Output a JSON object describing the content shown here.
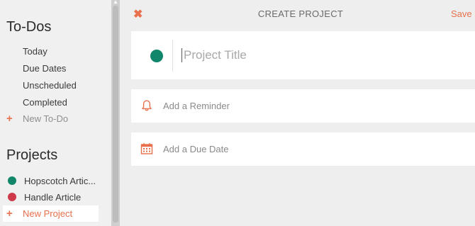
{
  "sidebar": {
    "todos_title": "To-Dos",
    "todo_items": [
      {
        "label": "Today"
      },
      {
        "label": "Due Dates"
      },
      {
        "label": "Unscheduled"
      },
      {
        "label": "Completed"
      }
    ],
    "new_todo_label": "New To-Do",
    "projects_title": "Projects",
    "projects": [
      {
        "label": "Hopscotch Artic...",
        "color": "#11866b"
      },
      {
        "label": "Handle Article",
        "color": "#cf3a4a"
      }
    ],
    "new_project_label": "New Project"
  },
  "header": {
    "close_icon": "close-icon",
    "title": "CREATE PROJECT",
    "save_label": "Save"
  },
  "form": {
    "project_color": "#11866b",
    "title_placeholder": "Project Title",
    "title_value": "",
    "reminder_icon": "bell-icon",
    "reminder_label": "Add a Reminder",
    "due_icon": "calendar-icon",
    "due_label": "Add a Due Date"
  },
  "colors": {
    "accent": "#e8704c",
    "sidebar_bg": "#f0f0f0",
    "main_bg": "#eeeeee"
  }
}
